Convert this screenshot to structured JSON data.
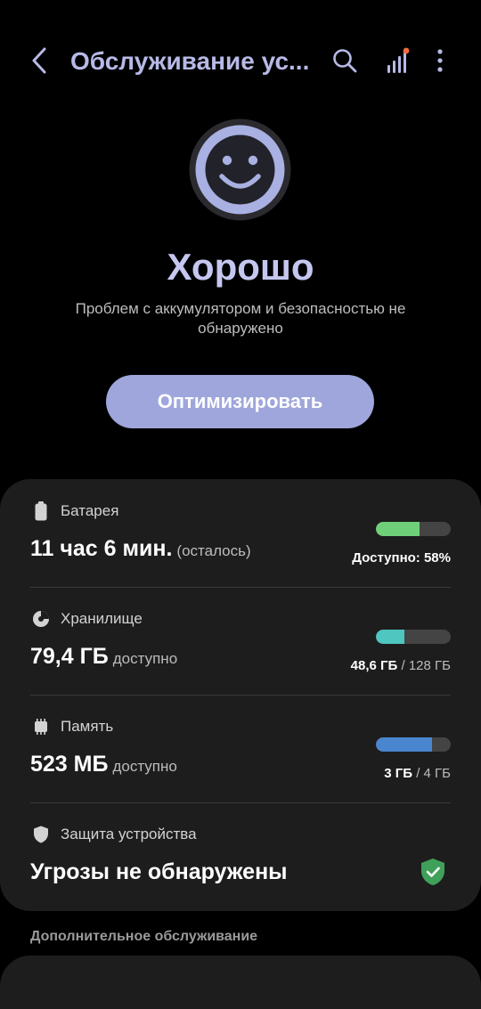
{
  "header": {
    "title": "Обслуживание ус...",
    "back_icon": "chevron-left-icon",
    "search_icon": "search-icon",
    "signal_icon": "signal-bars-icon",
    "more_icon": "more-vertical-icon"
  },
  "status": {
    "title": "Хорошо",
    "description": "Проблем с аккумулятором и безопасностью не обнаружено",
    "icon": "smiley-face-icon"
  },
  "optimize_button": "Оптимизировать",
  "battery": {
    "label": "Батарея",
    "value": "11 час 6 мин.",
    "suffix": "(осталось)",
    "available": "Доступно: 58%",
    "level": 0.58,
    "color": "#6fd07a"
  },
  "storage": {
    "label": "Хранилище",
    "value": "79,4 ГБ",
    "suffix": "доступно",
    "used": "48,6 ГБ",
    "total": "/ 128 ГБ",
    "level": 0.38,
    "color": "#4fc6c0"
  },
  "memory": {
    "label": "Память",
    "value": "523 МБ",
    "suffix": "доступно",
    "used": "3 ГБ",
    "total": "/ 4 ГБ",
    "level": 0.75,
    "color": "#4a86d0"
  },
  "protection": {
    "label": "Защита устройства",
    "status": "Угрозы не обнаружены",
    "status_color": "#3fa05a"
  },
  "additional_section": "Дополнительное обслуживание",
  "colors": {
    "accent": "#9ea6dc",
    "title": "#b7b9e6",
    "notification_dot": "#f26b3a"
  }
}
